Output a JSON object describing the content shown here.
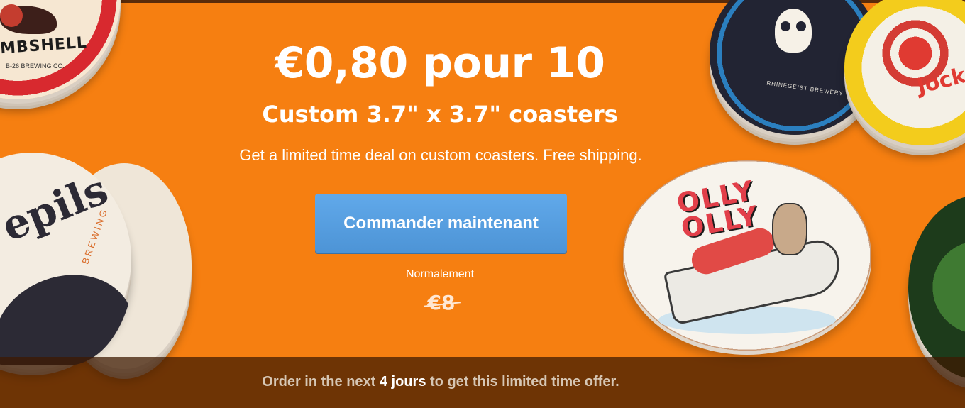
{
  "banner": {
    "headline": "€0,80 pour 10",
    "subheadline": "Custom 3.7\" x 3.7\" coasters",
    "description": "Get a limited time deal on custom coasters. Free shipping.",
    "cta_label": "Commander maintenant",
    "normally_label": "Normalement",
    "original_price": "€8",
    "background_color": "#f67f11",
    "button_color": "#5aa1e2"
  },
  "coasters": {
    "bombshell_text": "MBSHELL",
    "bombshell_sub": "B-26 BREWING CO.",
    "utepils_text": "epils",
    "utepils_brewing": "BREWING",
    "rhineist_text": "RHINEGEIST BREWERY",
    "jocky_text": "Jock",
    "olly_text": "OLLY OLLY"
  },
  "footer": {
    "prefix": "Order in the next",
    "highlight": "4 jours",
    "suffix": "to get this limited time offer."
  }
}
